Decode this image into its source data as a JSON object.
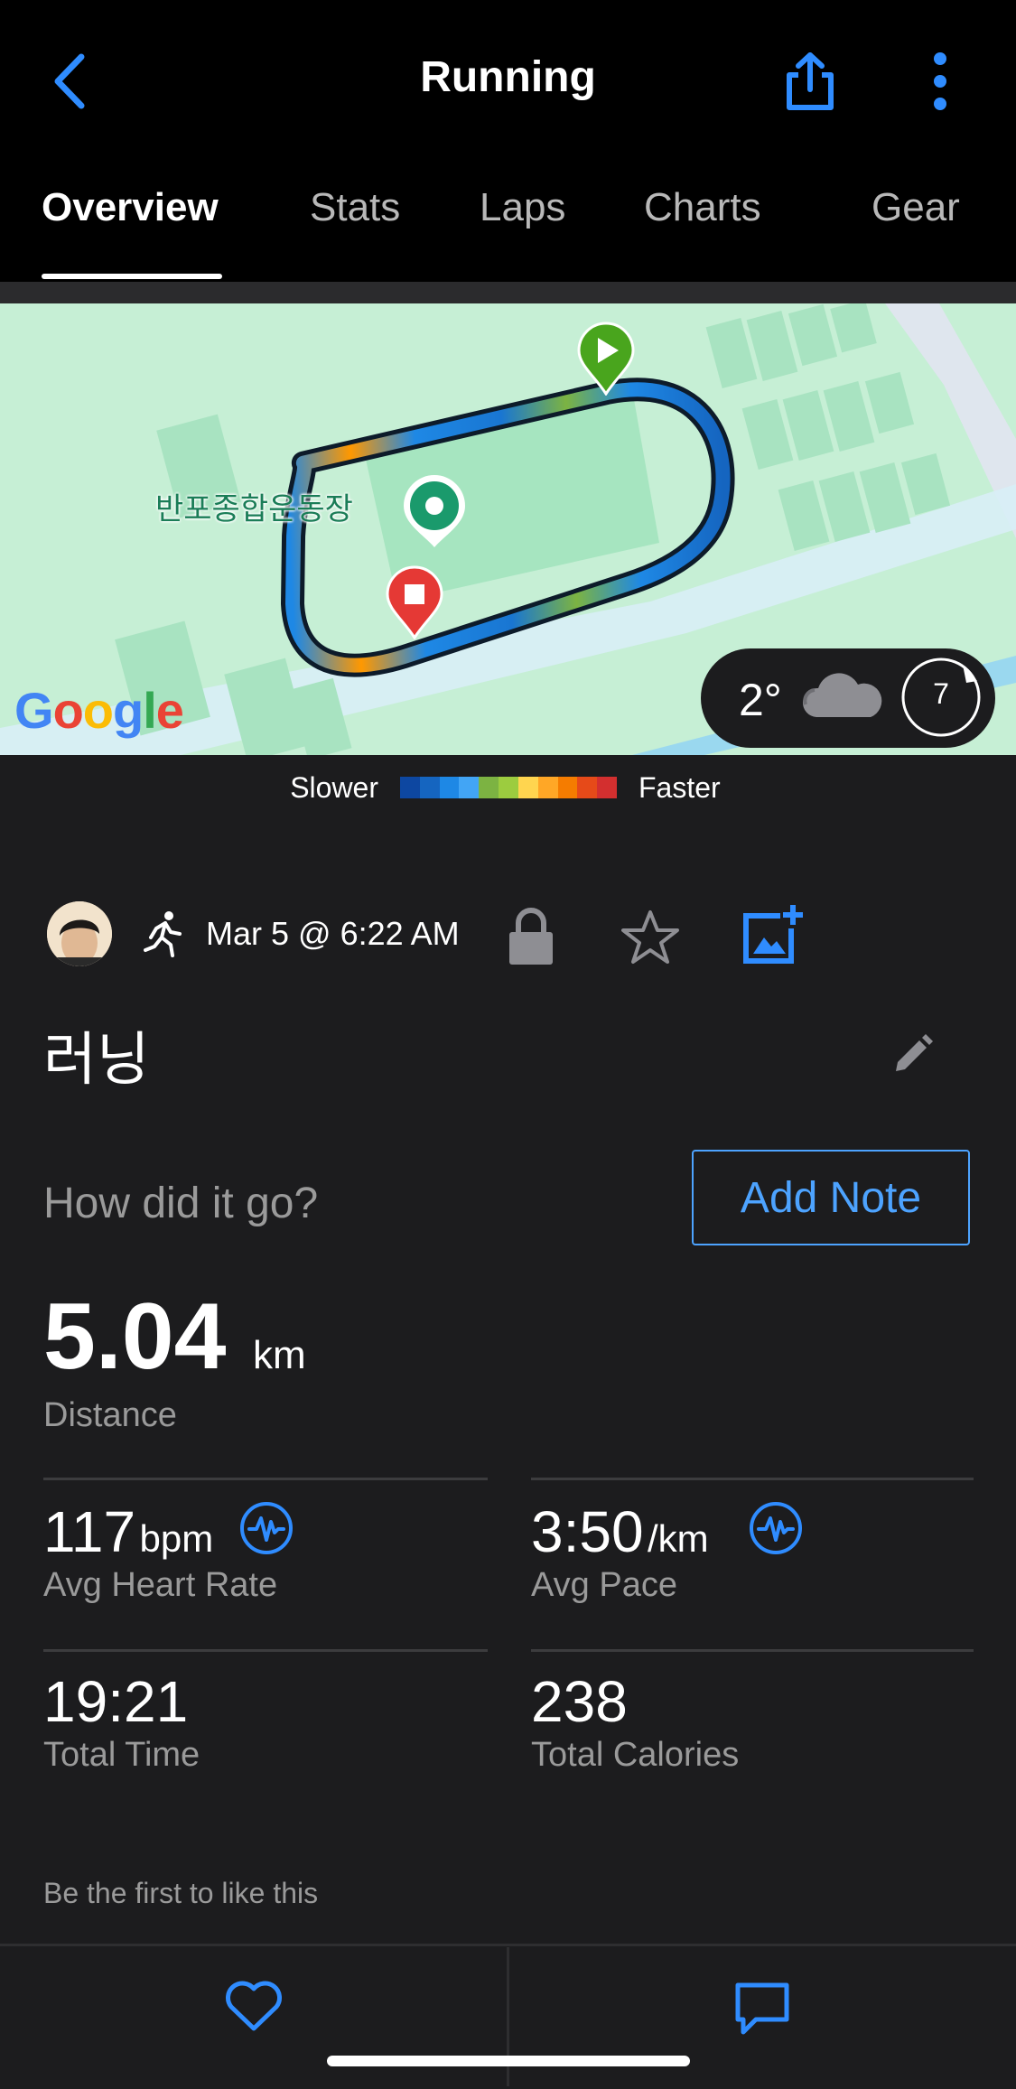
{
  "header": {
    "title": "Running",
    "tabs": [
      {
        "label": "Overview"
      },
      {
        "label": "Stats"
      },
      {
        "label": "Laps"
      },
      {
        "label": "Charts"
      },
      {
        "label": "Gear"
      }
    ],
    "active_tab": "Overview"
  },
  "map": {
    "place_label": "반포종합운동장",
    "provider": "Google",
    "weather": {
      "temperature": "2°",
      "icon": "cloud-icon",
      "wind": "7"
    }
  },
  "legend": {
    "slower_label": "Slower",
    "faster_label": "Faster",
    "colors": [
      "#0d47a1",
      "#1565c0",
      "#1e88e5",
      "#42a5f5",
      "#7cb342",
      "#9ccc3f",
      "#ffd54f",
      "#ffa726",
      "#f57c00",
      "#e64a19",
      "#d32f2f"
    ]
  },
  "activity": {
    "date": "Mar 5 @ 6:22 AM",
    "name": "러닝",
    "note_prompt": "How did it go?",
    "add_note_label": "Add Note"
  },
  "stats": {
    "distance": {
      "value": "5.04",
      "unit": "km",
      "label": "Distance"
    },
    "heart_rate": {
      "value": "117",
      "unit": "bpm",
      "label": "Avg Heart Rate"
    },
    "pace": {
      "value": "3:50",
      "unit": "/km",
      "label": "Avg Pace"
    },
    "time": {
      "value": "19:21",
      "label": "Total Time"
    },
    "calories": {
      "value": "238",
      "label": "Total Calories"
    }
  },
  "social": {
    "likes_text": "Be the first to like this"
  },
  "colors": {
    "accent": "#4da3ff",
    "background": "#1c1c1e",
    "header": "#000000"
  }
}
